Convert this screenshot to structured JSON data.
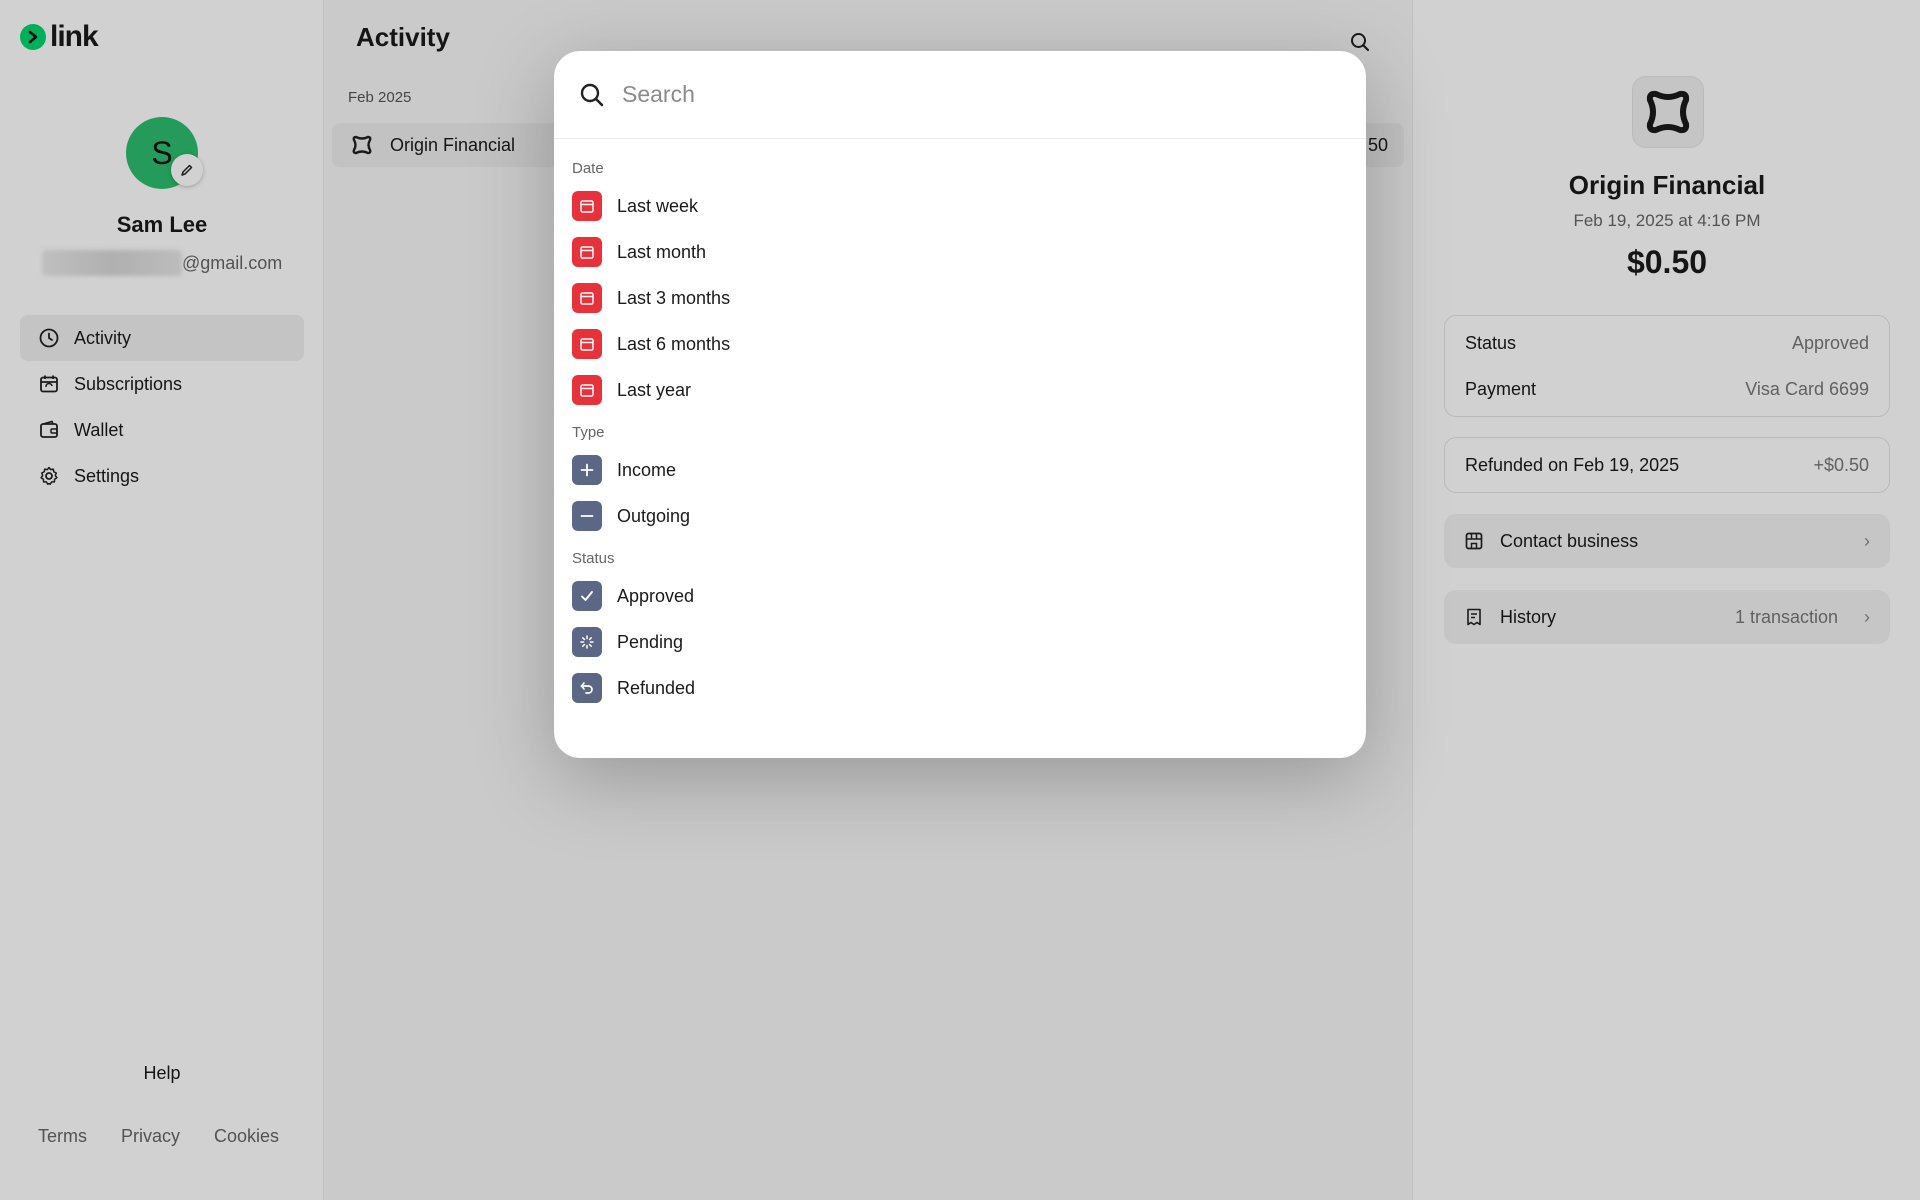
{
  "brand": {
    "name": "link",
    "color": "#00d66f"
  },
  "user": {
    "initial": "S",
    "name": "Sam Lee",
    "email_suffix": "@gmail.com"
  },
  "nav": [
    {
      "label": "Activity",
      "icon": "clock-icon",
      "active": true
    },
    {
      "label": "Subscriptions",
      "icon": "calendar-repeat-icon"
    },
    {
      "label": "Wallet",
      "icon": "wallet-icon"
    },
    {
      "label": "Settings",
      "icon": "gear-icon"
    }
  ],
  "help_label": "Help",
  "footer": {
    "terms": "Terms",
    "privacy": "Privacy",
    "cookies": "Cookies"
  },
  "main": {
    "title": "Activity",
    "month": "Feb 2025",
    "transaction": {
      "merchant": "Origin Financial",
      "amount": "50"
    }
  },
  "detail": {
    "merchant": "Origin Financial",
    "datetime": "Feb 19, 2025 at 4:16 PM",
    "amount": "$0.50",
    "status_label": "Status",
    "status_value": "Approved",
    "payment_label": "Payment",
    "payment_value": "Visa Card 6699",
    "refund_label": "Refunded on Feb 19, 2025",
    "refund_value": "+$0.50",
    "contact_label": "Contact business",
    "history_label": "History",
    "history_meta": "1 transaction"
  },
  "search_modal": {
    "placeholder": "Search",
    "sections": {
      "date": {
        "label": "Date",
        "options": [
          "Last week",
          "Last month",
          "Last 3 months",
          "Last 6 months",
          "Last year"
        ]
      },
      "type": {
        "label": "Type",
        "options": [
          "Income",
          "Outgoing"
        ]
      },
      "status": {
        "label": "Status",
        "options": [
          "Approved",
          "Pending",
          "Refunded"
        ]
      }
    }
  },
  "colors": {
    "date_icon": "#e8323b",
    "filter_icon": "#5b6785",
    "avatar": "#2dbd6e"
  }
}
